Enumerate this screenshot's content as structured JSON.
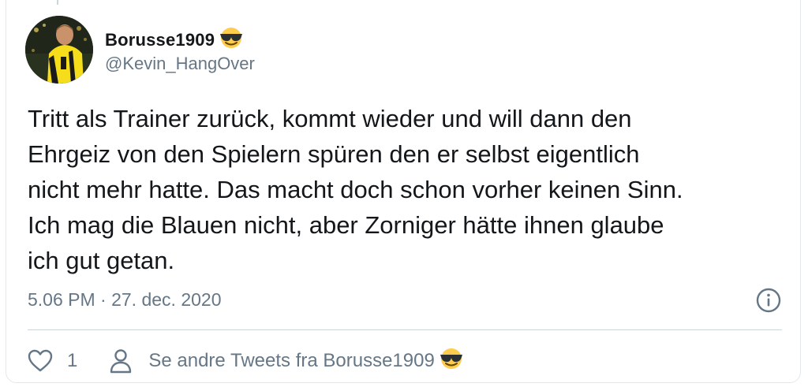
{
  "tweet": {
    "display_name": "Borusse1909",
    "display_name_emoji": "smiling-face-with-sunglasses-icon",
    "handle": "@Kevin_HangOver",
    "text": "Tritt als Trainer zurück, kommt wieder und will dann den\nEhrgeiz von den Spielern spüren den er selbst eigentlich\nnicht mehr hatte. Das macht doch schon vorher keinen Sinn.\nIch mag die Blauen nicht, aber Zorniger hätte ihnen glaube\nich gut getan.",
    "timestamp": "5.06 PM · 27. dec. 2020",
    "like_count": "1",
    "more_tweets_label": "Se andre Tweets fra Borusse1909"
  },
  "icons": {
    "info": "info-icon",
    "like": "heart-icon",
    "profile": "person-icon",
    "emoji": "smiling-face-with-sunglasses-icon"
  },
  "colors": {
    "text": "#14171a",
    "secondary": "#657786",
    "border": "#e1e8ed",
    "divider": "#ccd6dd",
    "emoji_face": "#ffcc4d"
  }
}
